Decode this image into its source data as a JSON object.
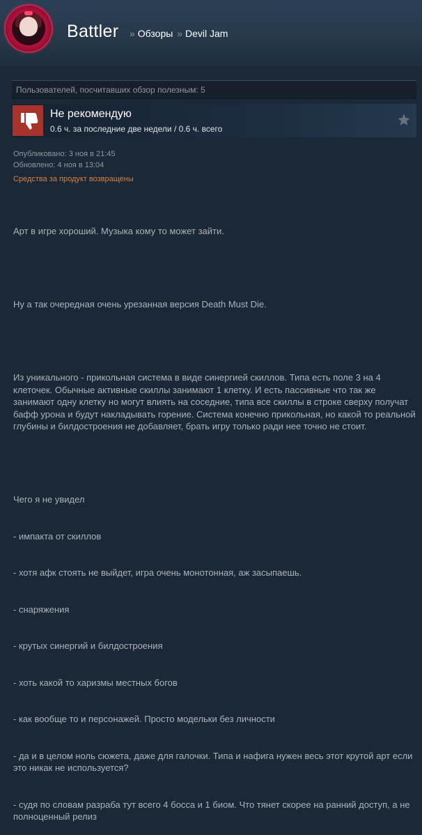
{
  "header": {
    "persona_name": "Battler",
    "crumb_sep": "»",
    "crumb_reviews": "Обзоры",
    "crumb_game": "Devil Jam"
  },
  "helpful": {
    "text": "Пользователей, посчитавших обзор полезным: 5"
  },
  "verdict": {
    "title": "Не рекомендую",
    "hours": "0.6 ч. за последние две недели / 0.6 ч. всего",
    "icon": "thumbs-down-icon"
  },
  "dates": {
    "posted": "Опубликовано: 3 ноя в 21:45",
    "updated": "Обновлено: 4 ноя в 13:04"
  },
  "refund": "Средства за продукт возвращены",
  "review": {
    "p1": "Арт в игре хороший. Музыка кому то может зайти.",
    "p2": "Ну а так очередная очень урезанная версия Death Must Die.",
    "p3": "Из уникального - прикольная система в виде синергией скиллов. Типа есть поле 3 на 4 клеточек. Обычные активные скиллы занимают 1 клетку. И есть пассивные что так же занимают одну клетку но могут влиять на соседние, типа все скиллы в строке сверху получат бафф урона и будут накладывать горение. Система конечно прикольная, но какой то реальной глубины и билдостроения не добавляет, брать игру только ради нее точно не стоит.",
    "list_intro": "Чего я не увидел",
    "list": [
      "- импакта от скиллов",
      "- хотя афк стоять не выйдет, игра очень монотонная, аж засыпаешь.",
      "- снаряжения",
      "- крутых синергий и билдостроения",
      "- хоть какой то харизмы местных богов",
      "- как вообще то и персонажей. Просто модельки без личности",
      "- да и в целом ноль сюжета, даже для галочки. Типа и нафига нужен весь этот крутой арт если это никак не используется?",
      "- судя по словам разраба тут всего 4 босса и 1 биом. Что тянет скорее на ранний доступ, а не полноценный релиз"
    ]
  },
  "colors": {
    "background": "#1b2838",
    "thumb_bg": "#a8332a",
    "refund": "#d4823f"
  }
}
